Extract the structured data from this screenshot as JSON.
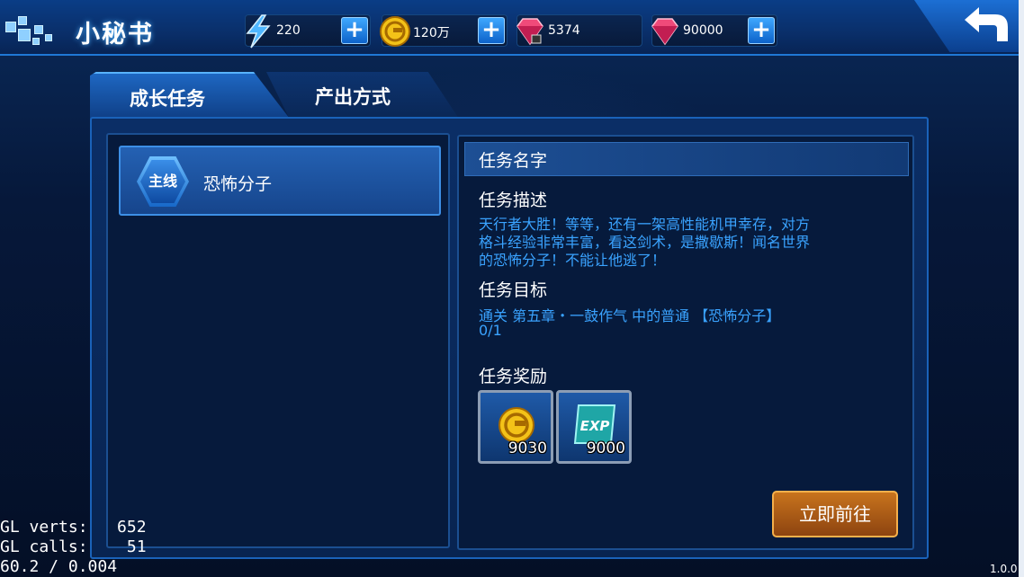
{
  "header": {
    "title": "小秘书",
    "energy": "220",
    "gold": "120万",
    "locked_gems": "5374",
    "gems": "90000",
    "plus_glyph": "+"
  },
  "tabs": [
    {
      "label": "成长任务",
      "active": true
    },
    {
      "label": "产出方式",
      "active": false
    }
  ],
  "task_list": [
    {
      "badge": "主线",
      "name": "恐怖分子"
    }
  ],
  "detail": {
    "name_label": "任务名字",
    "desc_label": "任务描述",
    "desc_lines": [
      "天行者大胜！等等，还有一架高性能机甲幸存，对方",
      "格斗经验非常丰富，看这剑术，是撒歇斯！闻名世界",
      "的恐怖分子！不能让他逃了！"
    ],
    "goal_label": "任务目标",
    "goal_text": "通关 第五章・一鼓作气 中的普通 【恐怖分子】",
    "goal_progress": "0/1",
    "reward_label": "任务奖励",
    "rewards": [
      {
        "icon": "gold-coin-icon",
        "amount": "9030"
      },
      {
        "icon": "exp-card-icon",
        "amount": "9000"
      }
    ],
    "go_button": "立即前往"
  },
  "debug": {
    "line1": "GL verts:   652",
    "line2": "GL calls:    51",
    "line3": "60.2 / 0.004"
  },
  "version": "1.0.0",
  "colors": {
    "accent_blue": "#3aa3ff",
    "panel_dark": "#061a3c",
    "button_orange": "#c8741d"
  }
}
